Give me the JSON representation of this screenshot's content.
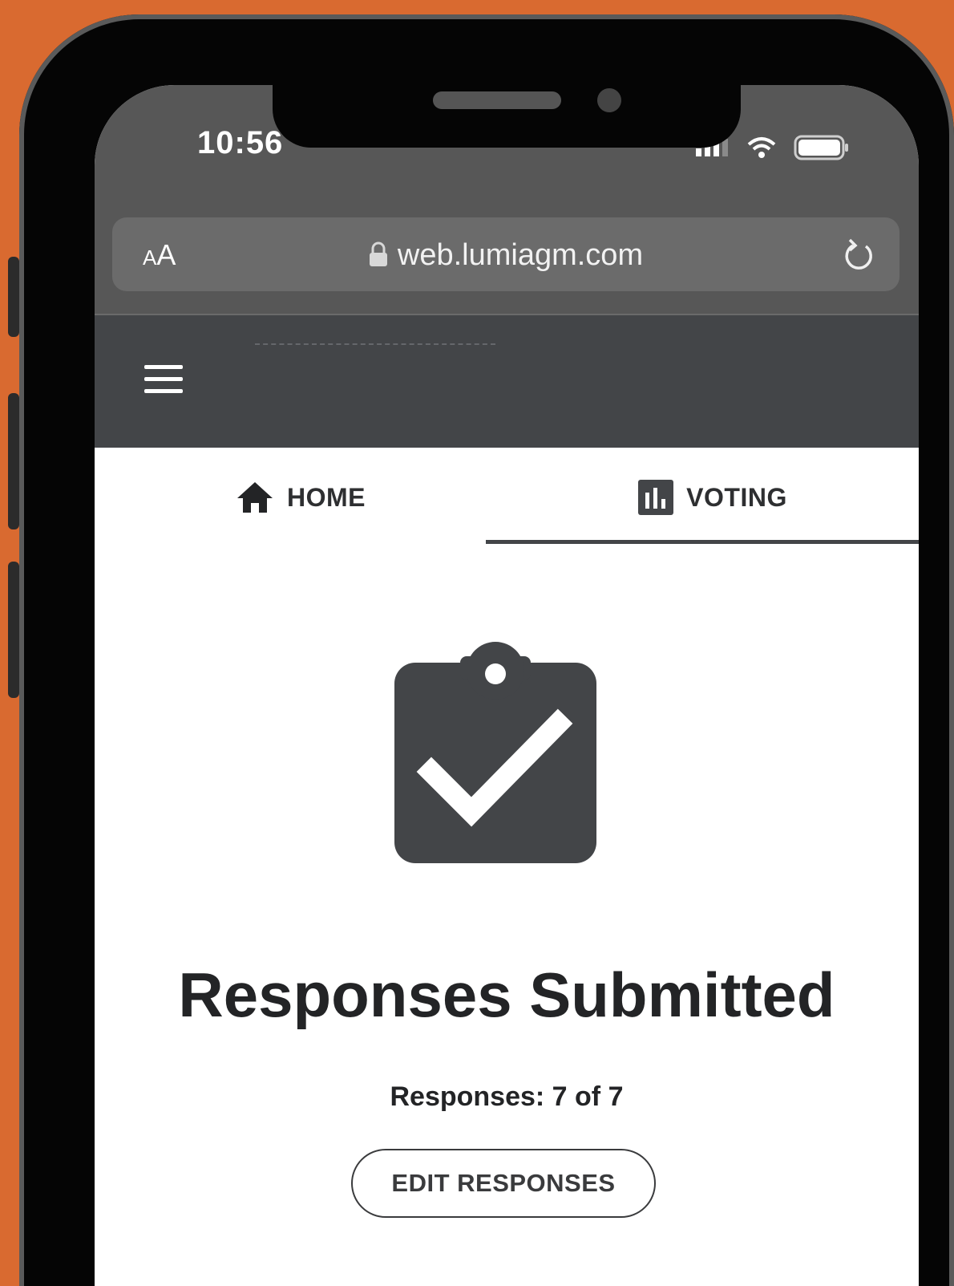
{
  "status_bar": {
    "time": "10:56",
    "icons": [
      "signal-icon",
      "wifi-icon",
      "battery-icon"
    ]
  },
  "browser": {
    "text_size_small": "A",
    "text_size_large": "A",
    "url": "web.lumiagm.com",
    "icons": [
      "lock-icon",
      "reload-icon"
    ]
  },
  "app_header": {
    "menu_icon": "hamburger-menu-icon"
  },
  "tabs": [
    {
      "label": "HOME",
      "icon": "home-icon",
      "active": false
    },
    {
      "label": "VOTING",
      "icon": "bar-chart-icon",
      "active": true
    }
  ],
  "main": {
    "icon": "clipboard-check-icon",
    "title": "Responses Submitted",
    "responses_count": "Responses: 7 of 7",
    "edit_button_label": "EDIT RESPONSES"
  },
  "colors": {
    "background_accent": "#d96a30",
    "header_bg": "#434548",
    "browser_chrome": "#575757",
    "text_dark": "#232426"
  }
}
